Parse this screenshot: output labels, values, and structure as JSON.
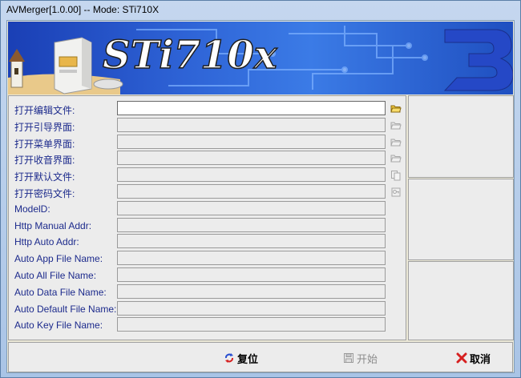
{
  "window": {
    "title": "AVMerger[1.0.00] -- Mode: STi710X"
  },
  "banner": {
    "logo_text": "STi710x"
  },
  "form": {
    "rows": [
      {
        "label": "打开编辑文件:",
        "value": "",
        "icon": "folder-open-icon"
      },
      {
        "label": "打开引导界面:",
        "value": "",
        "icon": "folder-open-icon"
      },
      {
        "label": "打开菜单界面:",
        "value": "",
        "icon": "folder-open-icon"
      },
      {
        "label": "打开收音界面:",
        "value": "",
        "icon": "folder-open-icon"
      },
      {
        "label": "打开默认文件:",
        "value": "",
        "icon": "copy-file-icon"
      },
      {
        "label": "打开密码文件:",
        "value": "",
        "icon": "key-file-icon"
      },
      {
        "label": "ModelD:",
        "value": ""
      },
      {
        "label": "Http Manual Addr:",
        "value": ""
      },
      {
        "label": "Http Auto Addr:",
        "value": ""
      },
      {
        "label": "Auto App File Name:",
        "value": ""
      },
      {
        "label": "Auto All File Name:",
        "value": ""
      },
      {
        "label": "Auto Data File Name:",
        "value": ""
      },
      {
        "label": "Auto Default File Name:",
        "value": ""
      },
      {
        "label": "Auto Key File Name:",
        "value": ""
      }
    ]
  },
  "buttons": {
    "reset_label": "复位",
    "start_label": "开始",
    "cancel_label": "取消"
  },
  "colors": {
    "label_text": "#1c2a8c",
    "cancel_icon": "#d62020",
    "reset_icon": "#2a4fd0"
  }
}
